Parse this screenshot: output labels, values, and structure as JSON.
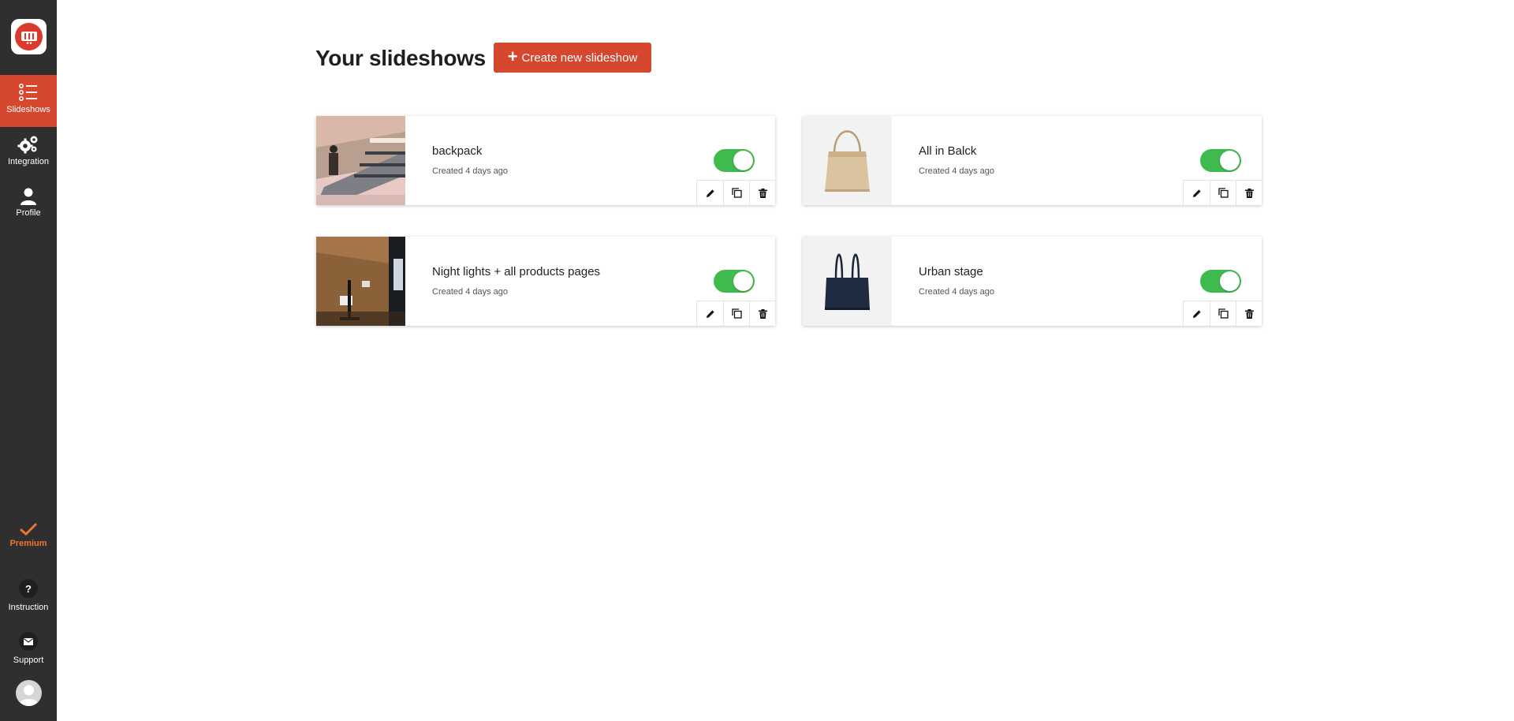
{
  "sidebar": {
    "items": [
      {
        "label": "Slideshows",
        "icon": "list-icon",
        "active": true
      },
      {
        "label": "Integration",
        "icon": "gears-icon",
        "active": false
      },
      {
        "label": "Profile",
        "icon": "person-icon",
        "active": false
      }
    ],
    "premium": {
      "label": "Premium",
      "icon": "check-icon"
    },
    "instruction": {
      "label": "Instruction",
      "icon": "question-icon",
      "glyph": "?"
    },
    "support": {
      "label": "Support",
      "icon": "mail-icon"
    }
  },
  "header": {
    "title": "Your slideshows",
    "create_label": "Create new slideshow"
  },
  "colors": {
    "accent": "#d5472e",
    "sidebar": "#2f2f2f",
    "toggle_on": "#3fba4f",
    "premium": "#f0752f"
  },
  "slideshows": [
    {
      "title": "backpack",
      "created": "Created 4 days ago",
      "enabled": true,
      "thumb": "street-scene"
    },
    {
      "title": "All in Balck",
      "created": "Created 4 days ago",
      "enabled": true,
      "thumb": "beige-tote"
    },
    {
      "title": "Night lights + all products pages",
      "created": "Created 4 days ago",
      "enabled": true,
      "thumb": "brown-box"
    },
    {
      "title": "Urban stage",
      "created": "Created 4 days ago",
      "enabled": true,
      "thumb": "navy-tote"
    }
  ]
}
